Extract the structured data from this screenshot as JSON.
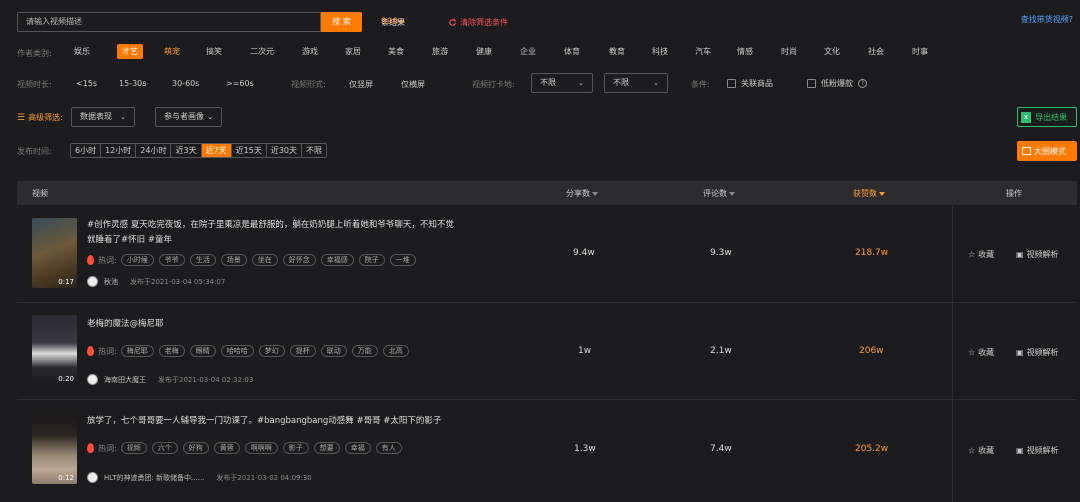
{
  "search": {
    "placeholder": "请输入视频描述",
    "button": "搜 索"
  },
  "results": {
    "count": "999+",
    "suffix": "条结果"
  },
  "clear_filter": "清除筛选条件",
  "find_video": "查找带货视频?",
  "author_category": {
    "label": "作者类别:",
    "items": [
      "娱乐",
      "才艺",
      "萌宠",
      "搞笑",
      "二次元",
      "游戏",
      "家居",
      "美食",
      "旅游",
      "健康",
      "企业",
      "体育",
      "教育",
      "科技",
      "汽车",
      "情感",
      "时尚",
      "文化",
      "社会",
      "时事"
    ],
    "active_index": 1,
    "orange_index": 2
  },
  "duration": {
    "label": "视频时长:",
    "items": [
      "<15s",
      "15-30s",
      "30-60s",
      ">=60s"
    ]
  },
  "form": {
    "label": "视频形式:",
    "items": [
      "仅竖屏",
      "仅横屏"
    ]
  },
  "checkin": {
    "label": "视频打卡地:",
    "select1": "不限",
    "select2": "不限"
  },
  "conditions": {
    "label": "条件:",
    "opt1": "关联商品",
    "opt2": "低粉爆款"
  },
  "advanced": {
    "label": "高级筛选:",
    "select1": "数据表现",
    "select2": "参与者画像"
  },
  "export_btn": "导出结果",
  "big_mode_btn": "大图模式",
  "publish_time": {
    "label": "发布时间:",
    "items": [
      "6小时",
      "12小时",
      "24小时",
      "近3天",
      "近7天",
      "近15天",
      "近30天",
      "不限"
    ],
    "active_index": 4
  },
  "table": {
    "headers": {
      "video": "视频",
      "shares": "分享数",
      "comments": "评论数",
      "likes": "获赞数",
      "actions": "操作"
    },
    "hot_label": "热词:",
    "fav_label": "收藏",
    "analyze_label": "视频解析",
    "rows": [
      {
        "title": "#创作灵感 夏天吃完夜饭，在院子里乘凉是最舒服的，躺在奶奶腿上听着她和爷爷聊天，不知不觉就睡着了#怀旧 #童年",
        "tags": [
          "小时候",
          "爷爷",
          "生活",
          "场景",
          "坐在",
          "好怀念",
          "幸福感",
          "院子",
          "一堆"
        ],
        "author": "秋池",
        "time": "发布于2021-03-04 05:34:07",
        "duration": "0:17",
        "shares": "9.4w",
        "comments": "9.3w",
        "likes": "218.7w"
      },
      {
        "title": "老梅的魔法@梅尼耶",
        "tags": [
          "梅尼耶",
          "老梅",
          "眼睛",
          "哈哈哈",
          "梦幻",
          "提杯",
          "联动",
          "万能",
          "北高"
        ],
        "author": "海南田大魔王",
        "time": "发布于2021-03-04 02:32:03",
        "duration": "0:20",
        "shares": "1w",
        "comments": "2.1w",
        "likes": "206w"
      },
      {
        "title": "放学了，七个哥哥要一人辅导我一门功课了。#bangbangbang动感舞 #哥哥 #太阳下的影子",
        "tags": [
          "视频",
          "六个",
          "好狗",
          "黄蓉",
          "啊啊啊",
          "影子",
          "想要",
          "幸福",
          "有人"
        ],
        "author": "HLT的神迹勇团: 新歌储备中......",
        "time": "发布于2021-03-02 04:09:30",
        "duration": "0:12",
        "shares": "1.3w",
        "comments": "7.4w",
        "likes": "205.2w"
      }
    ]
  }
}
